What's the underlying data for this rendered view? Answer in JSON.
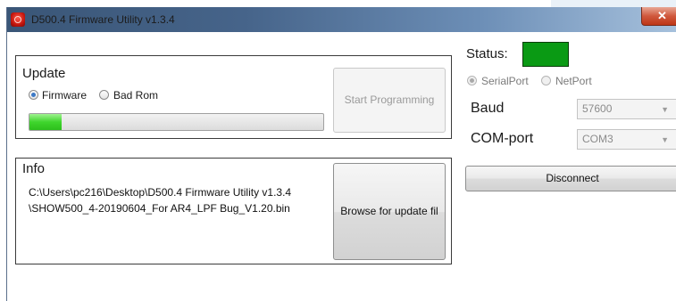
{
  "window": {
    "title": "D500.4 Firmware Utility v1.3.4",
    "close_glyph": "✕"
  },
  "update": {
    "title": "Update",
    "radio_firmware": "Firmware",
    "radio_badrom": "Bad Rom",
    "selected": "Firmware",
    "progress_percent": 11,
    "start_button": "Start Programming"
  },
  "info": {
    "title": "Info",
    "path_line1": "C:\\Users\\pc216\\Desktop\\D500.4 Firmware Utility v1.3.4",
    "path_line2": "\\SHOW500_4-20190604_For AR4_LPF Bug_V1.20.bin",
    "browse_button": "Browse for update fil"
  },
  "connection": {
    "status_label": "Status:",
    "status_color": "#0a9a14",
    "serial_port": "SerialPort",
    "net_port": "NetPort",
    "baud_label": "Baud",
    "baud_value": "57600",
    "com_label": "COM-port",
    "com_value": "COM3",
    "disconnect_button": "Disconnect"
  },
  "icons": {
    "app": "app-logo-icon",
    "dropdown": "chevron-down-icon"
  }
}
